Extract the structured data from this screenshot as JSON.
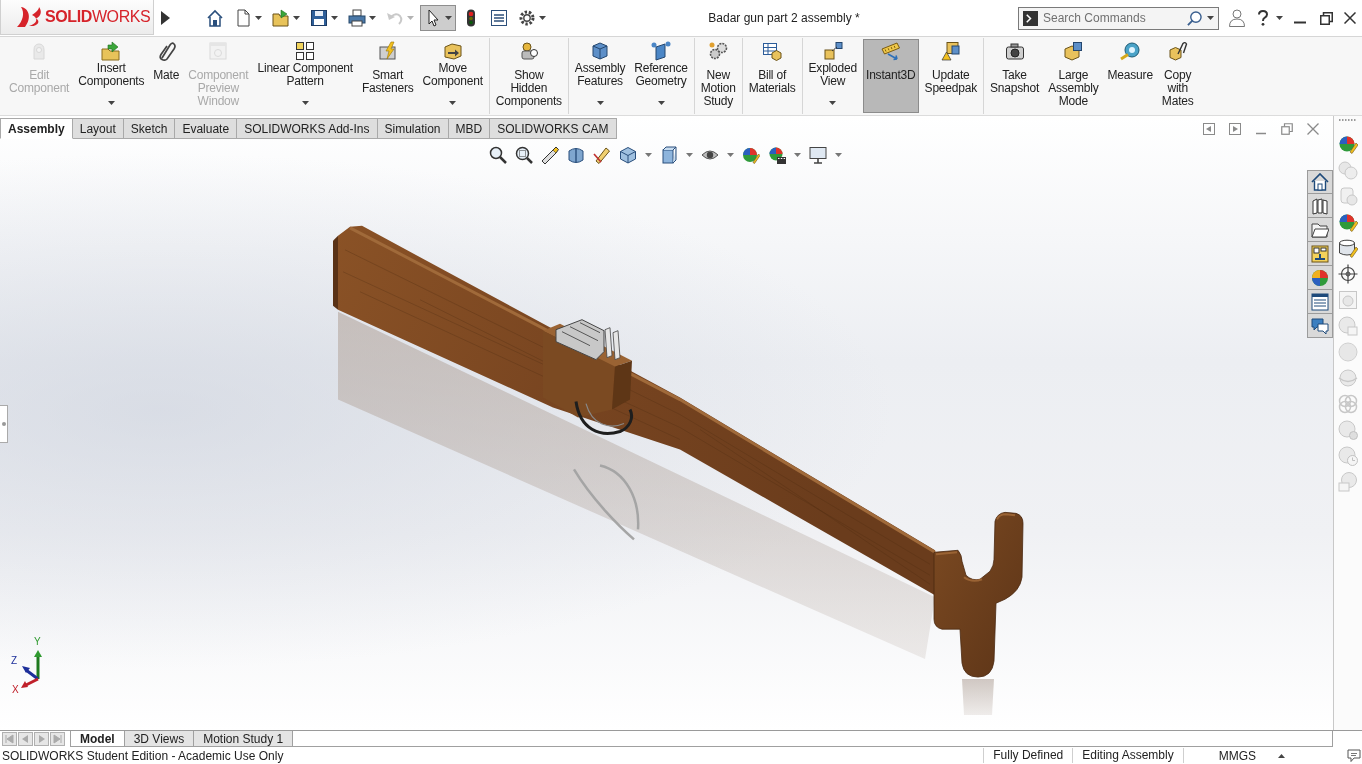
{
  "logo": {
    "text": "**SOLID**WORKS"
  },
  "quick_access": [
    {
      "dropdown": false,
      "disabled": false,
      "selected": false
    },
    {
      "dropdown": true,
      "disabled": false,
      "selected": false
    },
    {
      "dropdown": true,
      "disabled": false,
      "selected": false
    },
    {
      "dropdown": true,
      "disabled": false,
      "selected": false
    },
    {
      "dropdown": true,
      "disabled": false,
      "selected": false
    },
    {
      "dropdown": true,
      "disabled": true,
      "selected": false
    },
    {
      "dropdown": true,
      "disabled": false,
      "selected": true
    },
    {
      "dropdown": false,
      "disabled": false,
      "selected": false
    },
    {
      "dropdown": false,
      "disabled": false,
      "selected": false
    },
    {
      "dropdown": true,
      "disabled": false,
      "selected": false
    }
  ],
  "window": {
    "title": "Badar gun part 2 assembly *"
  },
  "search": {
    "placeholder": "Search Commands"
  },
  "ribbon": {
    "groups": [
      {
        "commands": [
          {
            "label": "Edit\nComponent",
            "disabled": true,
            "selected": false,
            "dropdown": false
          },
          {
            "label": "Insert\nComponents",
            "disabled": false,
            "selected": false,
            "dropdown": true
          },
          {
            "label": "Mate",
            "disabled": false,
            "selected": false,
            "dropdown": false
          },
          {
            "label": "Component\nPreview\nWindow",
            "disabled": true,
            "selected": false,
            "dropdown": false
          },
          {
            "label": "Linear Component\nPattern",
            "disabled": false,
            "selected": false,
            "dropdown": true
          },
          {
            "label": "Smart\nFasteners",
            "disabled": false,
            "selected": false,
            "dropdown": false
          },
          {
            "label": "Move\nComponent",
            "disabled": false,
            "selected": false,
            "dropdown": true
          }
        ]
      },
      {
        "commands": [
          {
            "label": "Show\nHidden\nComponents",
            "disabled": false,
            "selected": false,
            "dropdown": false
          }
        ]
      },
      {
        "commands": [
          {
            "label": "Assembly\nFeatures",
            "disabled": false,
            "selected": false,
            "dropdown": true
          },
          {
            "label": "Reference\nGeometry",
            "disabled": false,
            "selected": false,
            "dropdown": true
          }
        ]
      },
      {
        "commands": [
          {
            "label": "New\nMotion\nStudy",
            "disabled": false,
            "selected": false,
            "dropdown": false
          }
        ]
      },
      {
        "commands": [
          {
            "label": "Bill of\nMaterials",
            "disabled": false,
            "selected": false,
            "dropdown": false
          }
        ]
      },
      {
        "commands": [
          {
            "label": "Exploded\nView",
            "disabled": false,
            "selected": false,
            "dropdown": true
          },
          {
            "label": "Instant3D",
            "disabled": false,
            "selected": true,
            "dropdown": false
          },
          {
            "label": "Update\nSpeedpak",
            "disabled": false,
            "selected": false,
            "dropdown": false
          }
        ]
      },
      {
        "commands": [
          {
            "label": "Take\nSnapshot",
            "disabled": false,
            "selected": false,
            "dropdown": false
          },
          {
            "label": "Large\nAssembly\nMode",
            "disabled": false,
            "selected": false,
            "dropdown": false
          },
          {
            "label": "Measure",
            "disabled": false,
            "selected": false,
            "dropdown": false
          },
          {
            "label": "Copy\nwith\nMates",
            "disabled": false,
            "selected": false,
            "dropdown": false
          }
        ]
      }
    ]
  },
  "command_tabs": [
    {
      "label": "Assembly",
      "selected": true
    },
    {
      "label": "Layout",
      "selected": false
    },
    {
      "label": "Sketch",
      "selected": false
    },
    {
      "label": "Evaluate",
      "selected": false
    },
    {
      "label": "SOLIDWORKS Add-Ins",
      "selected": false
    },
    {
      "label": "Simulation",
      "selected": false
    },
    {
      "label": "MBD",
      "selected": false
    },
    {
      "label": "SOLIDWORKS CAM",
      "selected": false
    }
  ],
  "triad": {
    "x": "X",
    "y": "Y",
    "z": "Z"
  },
  "display_pane": [
    {
      "disabled": false
    },
    {
      "disabled": true
    },
    {
      "disabled": true
    },
    {
      "disabled": false
    },
    {
      "disabled": false
    },
    {
      "disabled": false
    },
    {
      "disabled": true
    },
    {
      "disabled": true
    },
    {
      "disabled": true
    },
    {
      "disabled": true
    },
    {
      "disabled": true
    },
    {
      "disabled": true
    },
    {
      "disabled": true
    },
    {
      "disabled": true
    }
  ],
  "bottom_tabs": [
    {
      "label": "Model",
      "selected": true
    },
    {
      "label": "3D Views",
      "selected": false
    },
    {
      "label": "Motion Study 1",
      "selected": false
    }
  ],
  "status_bar": {
    "message": "SOLIDWORKS Student Edition - Academic Use Only",
    "fields": [
      "Fully Defined",
      "Editing Assembly"
    ],
    "units": "MMGS"
  }
}
